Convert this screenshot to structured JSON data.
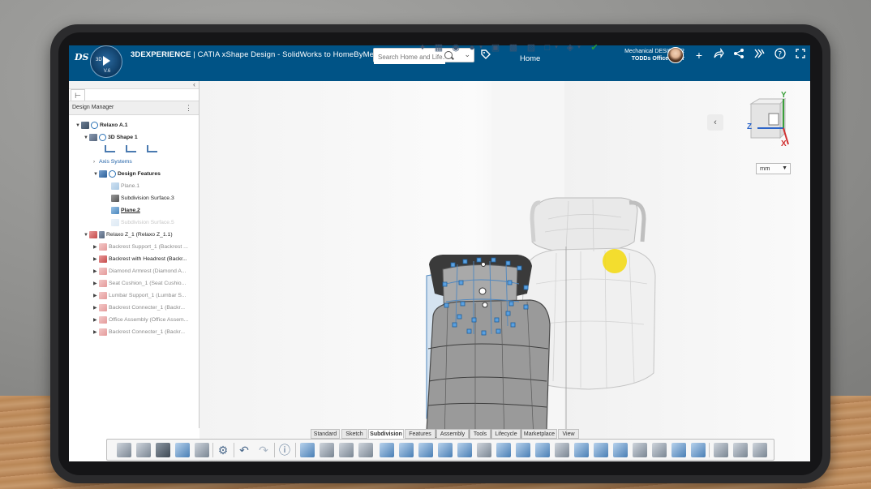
{
  "window": {
    "brand": "3DEXPERIENCE",
    "app_line": " | CATIA  xShape Design - SolidWorks to HomeByMe",
    "app_line_chevron": "∨",
    "compass_version": "V.6",
    "compass_3d": "3D"
  },
  "search": {
    "placeholder": "Search Home and Life..."
  },
  "header": {
    "home_tab": "Home",
    "role": "Mechanical DESIGNER",
    "context": "TODDs Office Chair"
  },
  "topbar_icons": [
    "add-icon",
    "share-icon",
    "network-icon",
    "tools-icon",
    "help-icon",
    "fullscreen-icon"
  ],
  "panel": {
    "title": "Design Manager",
    "collapse": "‹",
    "menu": "⋮"
  },
  "tree": {
    "root": "Relaxo A.1",
    "shape": "3D Shape 1",
    "axis_systems": "Axis Systems",
    "design_features": "Design Features",
    "plane1": "Plane.1",
    "subdivision_surface": "Subdivision Surface.3",
    "plane2": "Plane.2",
    "subdivision_faded": "Subdivision Surface.5",
    "relaxo_z": "Relaxo Z_1 (Relaxo Z_1.1)",
    "children": [
      "Backrest Support_1 (Backrest ...",
      "Backrest with Headrest (Backr...",
      "Diamond Armrest (Diamond A...",
      "Seat Cushion_1 (Seat Cushio...",
      "Lumbar Support_1 (Lumbar S...",
      "Backrest Connecter_1 (Backr...",
      "Office Assembly (Office Assem...",
      "Backrest Connecter_1 (Backr..."
    ]
  },
  "viewport": {
    "units": "mm",
    "axes": {
      "y": "Y",
      "z": "Z",
      "x": "X"
    }
  },
  "bottom_tabs": [
    "Standard",
    "Sketch",
    "Subdivision",
    "Features",
    "Assembly",
    "Tools",
    "Lifecycle",
    "Marketplace",
    "View"
  ],
  "active_tab": "Subdivision",
  "colors": {
    "topbar": "#005386",
    "accent": "#2c72b5",
    "highlight": "#f4d800"
  }
}
